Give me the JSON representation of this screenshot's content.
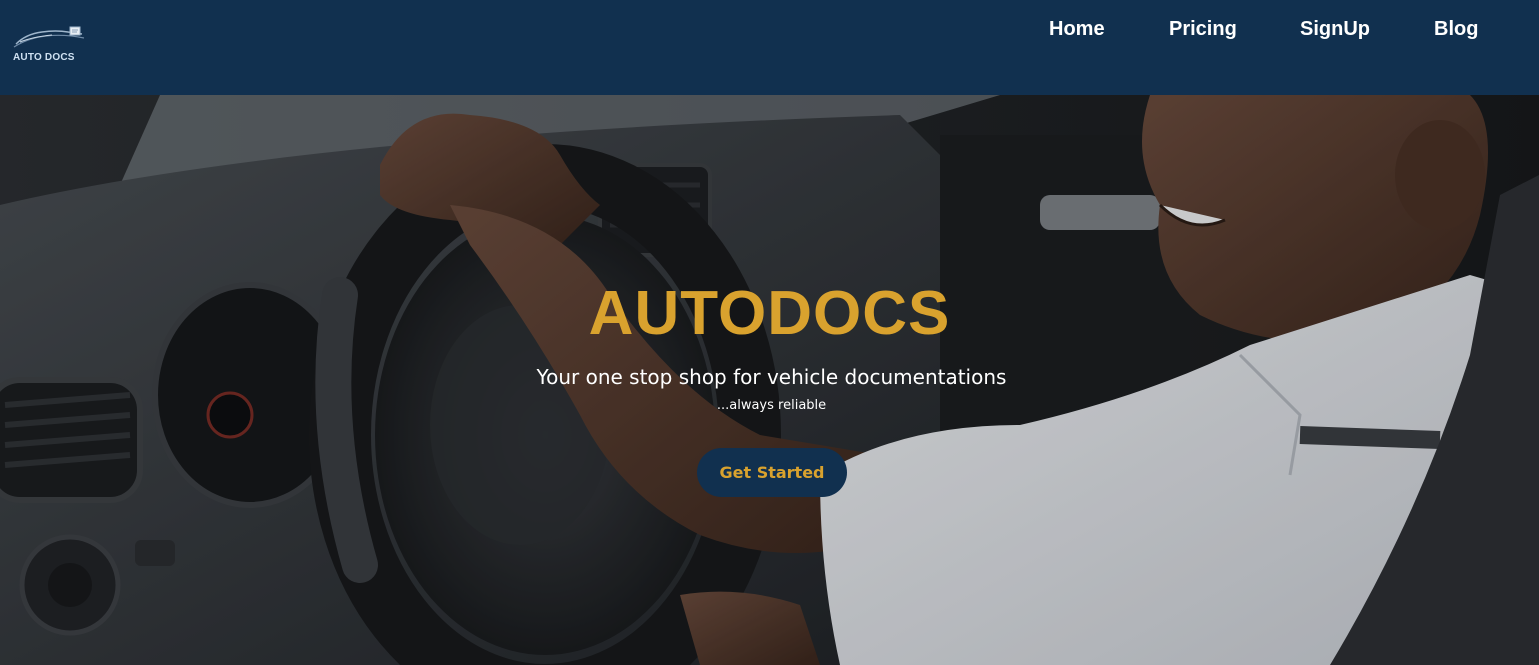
{
  "header": {
    "logo_text": "AUTO DOCS",
    "nav": [
      {
        "label": "Home"
      },
      {
        "label": "Pricing"
      },
      {
        "label": "SignUp"
      },
      {
        "label": "Blog"
      }
    ]
  },
  "hero": {
    "title": "AUTODOCS",
    "subtitle": "Your one stop shop for vehicle documentations",
    "tagline": "...always reliable",
    "cta_label": "Get Started",
    "image_alt": "Smiling man in white shirt driving a car, hands on steering wheel"
  },
  "colors": {
    "navy": "#11304f",
    "gold": "#d9a22e",
    "white": "#ffffff"
  },
  "icons": {
    "logo": "car-logo-icon"
  }
}
